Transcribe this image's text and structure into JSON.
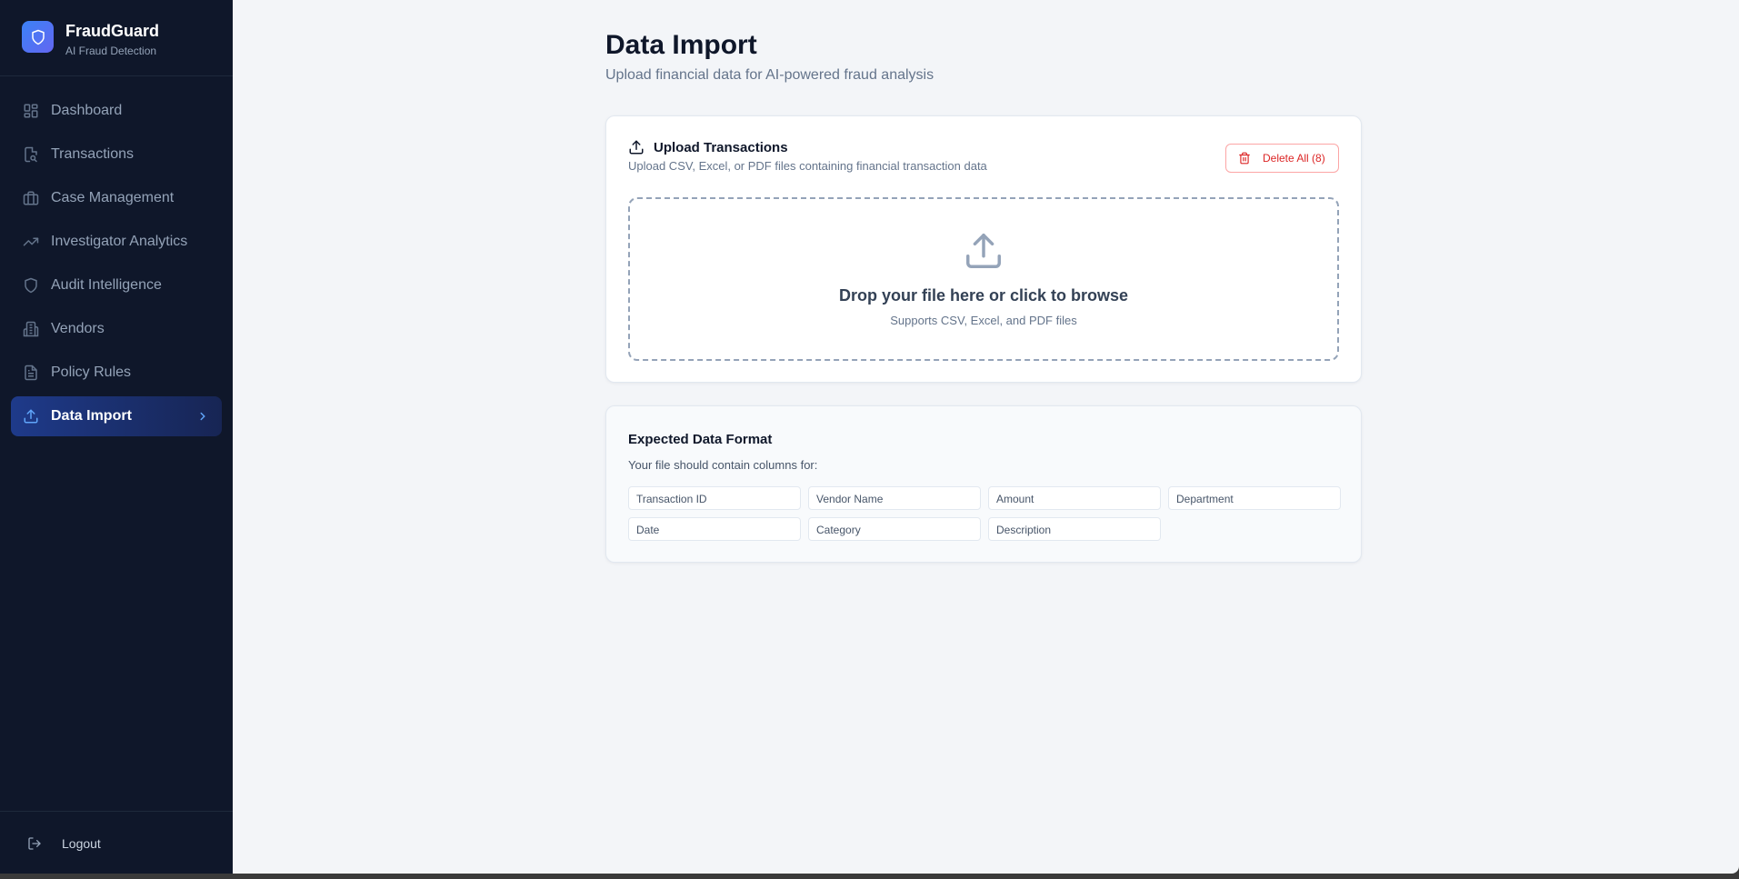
{
  "brand": {
    "name": "FraudGuard",
    "subtitle": "AI Fraud Detection"
  },
  "sidebar": {
    "items": [
      {
        "label": "Dashboard",
        "icon": "grid-icon"
      },
      {
        "label": "Transactions",
        "icon": "document-search-icon"
      },
      {
        "label": "Case Management",
        "icon": "briefcase-icon"
      },
      {
        "label": "Investigator Analytics",
        "icon": "trending-up-icon"
      },
      {
        "label": "Audit Intelligence",
        "icon": "shield-icon"
      },
      {
        "label": "Vendors",
        "icon": "building-icon"
      },
      {
        "label": "Policy Rules",
        "icon": "file-text-icon"
      },
      {
        "label": "Data Import",
        "icon": "upload-icon",
        "active": true
      }
    ],
    "logout_label": "Logout"
  },
  "page": {
    "title": "Data Import",
    "subtitle": "Upload financial data for AI-powered fraud analysis"
  },
  "upload": {
    "title": "Upload Transactions",
    "description": "Upload CSV, Excel, or PDF files containing financial transaction data",
    "delete_label": "Delete All (8)",
    "dropzone_title": "Drop your file here or click to browse",
    "dropzone_sub": "Supports CSV, Excel, and PDF files"
  },
  "format": {
    "title": "Expected Data Format",
    "description": "Your file should contain columns for:",
    "columns": [
      "Transaction ID",
      "Vendor Name",
      "Amount",
      "Department",
      "Date",
      "Category",
      "Description"
    ]
  },
  "colors": {
    "sidebar_bg": "#0f172a",
    "accent": "#3b82f6",
    "danger": "#dc2626"
  }
}
